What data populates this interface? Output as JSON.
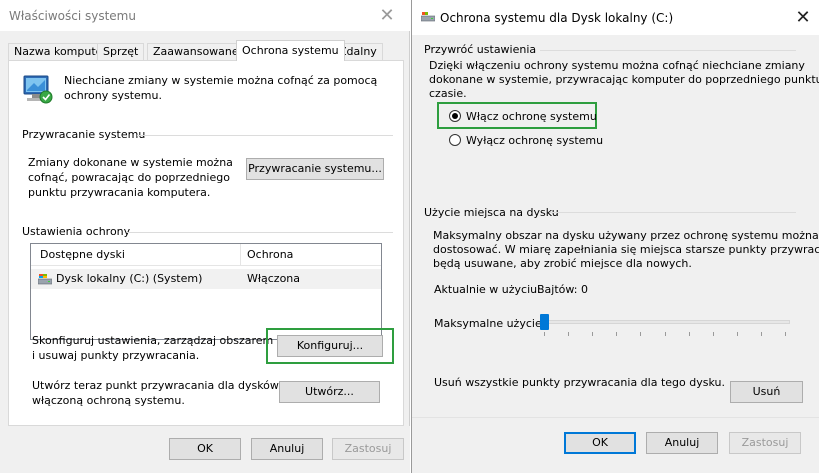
{
  "left_window": {
    "title": "Właściwości systemu",
    "close_symbol": "✕",
    "tabs": [
      {
        "label": "Nazwa komputera",
        "active": false
      },
      {
        "label": "Sprzęt",
        "active": false
      },
      {
        "label": "Zaawansowane",
        "active": false
      },
      {
        "label": "Ochrona systemu",
        "active": true
      },
      {
        "label": "Zdalny",
        "active": false
      }
    ],
    "intro_line1": "Niechciane zmiany w systemie można cofnąć za pomocą",
    "intro_line2": "ochrony systemu.",
    "restore_group": {
      "label": "Przywracanie systemu",
      "desc_line1": "Zmiany dokonane w systemie można",
      "desc_line2": "cofnąć, powracając do poprzedniego",
      "desc_line3": "punktu przywracania komputera.",
      "button": "Przywracanie systemu..."
    },
    "protection_group": {
      "label": "Ustawienia ochrony",
      "columns": [
        "Dostępne dyski",
        "Ochrona"
      ],
      "rows": [
        {
          "drive": "Dysk lokalny (C:) (System)",
          "protection": "Włączona"
        }
      ],
      "configure_line1": "Skonfiguruj ustawienia, zarządzaj obszarem dysku",
      "configure_line2": "i usuwaj punkty przywracania.",
      "configure_button": "Konfiguruj...",
      "create_line1": "Utwórz teraz punkt przywracania dla dysków z",
      "create_line2": "włączoną ochroną systemu.",
      "create_button": "Utwórz..."
    },
    "footer": {
      "ok": "OK",
      "cancel": "Anuluj",
      "apply": "Zastosuj"
    }
  },
  "right_window": {
    "title": "Ochrona systemu dla Dysk lokalny (C:)",
    "close_symbol": "✕",
    "restore_settings": {
      "label": "Przywróć ustawienia",
      "desc_line1": "Dzięki włączeniu ochrony systemu można cofnąć niechciane zmiany",
      "desc_line2": "dokonane w systemie, przywracając komputer do poprzedniego punktu w",
      "desc_line3": "czasie.",
      "radio_on": "Włącz ochronę systemu",
      "radio_off": "Wyłącz ochronę systemu",
      "selected": "on"
    },
    "disk_usage": {
      "label": "Użycie miejsca na dysku",
      "desc_line1": "Maksymalny obszar na dysku używany przez ochronę systemu można",
      "desc_line2": "dostosować. W miarę zapełniania się miejsca starsze punkty przywracania",
      "desc_line3": "będą usuwane, aby zrobić miejsce dla nowych.",
      "current_label": "Aktualnie w użyciu:",
      "current_value": "Bajtów: 0",
      "max_label": "Maksymalne użycie:",
      "max_usage_fraction": 0.0,
      "delete_text": "Usuń wszystkie punkty przywracania dla tego dysku.",
      "delete_button": "Usuń"
    },
    "footer": {
      "ok": "OK",
      "cancel": "Anuluj",
      "apply": "Zastosuj"
    }
  },
  "colors": {
    "highlight_box": "#2e9e3f",
    "focus_blue": "#0078d7",
    "dialog_bg": "#f0f0f0"
  },
  "icons": [
    "system-protection-monitor-icon",
    "drive-icon",
    "title-drive-icon",
    "close-icon"
  ]
}
